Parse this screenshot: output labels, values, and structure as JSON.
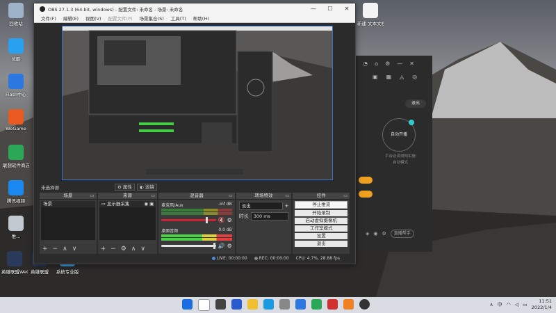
{
  "desktop": {
    "icons": [
      {
        "label": "回收站",
        "color": "#9fb3c8"
      },
      {
        "label": "优酷",
        "color": "#2aa0f0"
      },
      {
        "label": "Flash中心",
        "color": "#2a78e0"
      },
      {
        "label": "WeGame",
        "color": "#e85a20"
      },
      {
        "label": "联想软件商店",
        "color": "#2aa858"
      },
      {
        "label": "腾讯视频",
        "color": "#1a88f0"
      },
      {
        "label": "惟...",
        "color": "#c0c8d0"
      },
      {
        "label": "英雄联盟WeGame版",
        "color": "#2a3a5a"
      },
      {
        "label": "英雄联盟",
        "color": "#2a3a5a"
      },
      {
        "label": "系统专业版",
        "color": "#3aa0e0"
      },
      {
        "label": "新建 文本文档",
        "color": "#f4f4f4"
      }
    ]
  },
  "background_app": {
    "exit_label": "退出",
    "circle_label": "自动开播",
    "sub_text_1": "平台必读须知实施",
    "sub_text_2": "自动模式",
    "mini_label": "直播帮手"
  },
  "obs": {
    "title": "OBS 27.1.3 (64-bit, windows) - 配置文件: 未命名 - 场景: 未命名",
    "window_controls": {
      "minimize": "—",
      "maximize": "☐",
      "close": "✕"
    },
    "menu": [
      "文件(F)",
      "编辑(E)",
      "视图(V)",
      "配置文件(P)",
      "场景集合(S)",
      "工具(T)",
      "帮助(H)"
    ],
    "toolbar": {
      "no_source": "未选择源",
      "properties": "属性",
      "filters": "滤镜"
    },
    "docks": {
      "scenes": {
        "title": "场景",
        "items": [
          "场景"
        ]
      },
      "sources": {
        "title": "来源",
        "items": [
          "显示器采集"
        ]
      },
      "mixer": {
        "title": "混音器",
        "channels": [
          {
            "name": "麦克风/Aux",
            "level": "-inf dB"
          },
          {
            "name": "桌面音频",
            "level": "0.0 dB"
          }
        ]
      },
      "transitions": {
        "title": "转场特效",
        "selected": "淡出",
        "duration_label": "时长",
        "duration_value": "300 ms"
      },
      "controls": {
        "title": "控件",
        "buttons": [
          "停止推流",
          "开始录制",
          "启动虚拟摄像机",
          "工作室模式",
          "设置",
          "退出"
        ]
      }
    },
    "status": {
      "live": "LIVE: 00:00:00",
      "rec": "REC: 00:00:00",
      "cpu": "CPU: 4.7%, 28.88 fps"
    }
  },
  "taskbar": {
    "time": "11:51",
    "date": "2022/1/4",
    "lang": "中"
  }
}
